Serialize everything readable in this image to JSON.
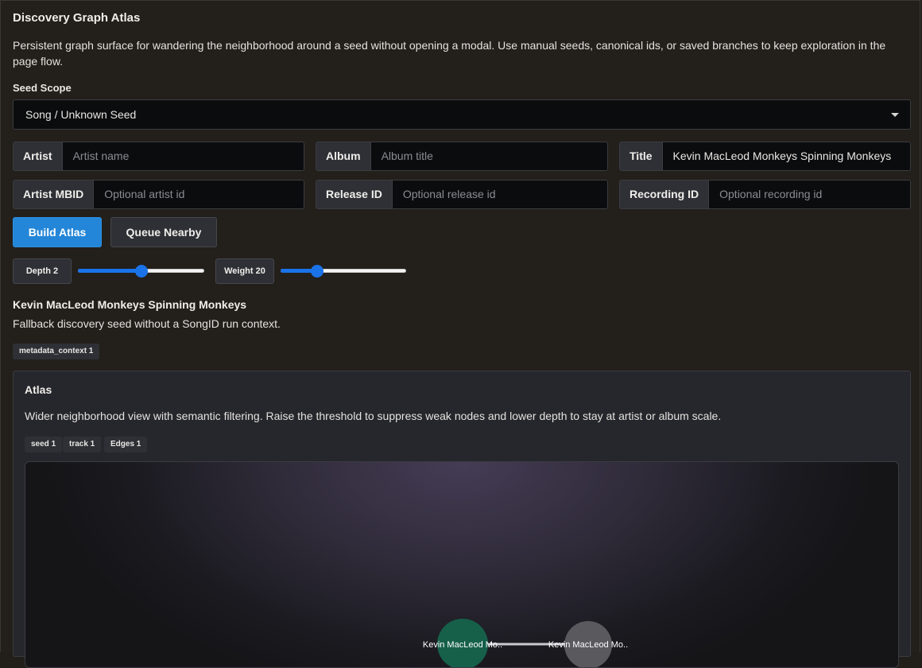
{
  "header": {
    "title": "Discovery Graph Atlas",
    "description": "Persistent graph surface for wandering the neighborhood around a seed without opening a modal. Use manual seeds, canonical ids, or saved branches to keep exploration in the page flow."
  },
  "scope": {
    "label": "Seed Scope",
    "selected": "Song / Unknown Seed"
  },
  "fields": {
    "artist": {
      "label": "Artist",
      "value": "",
      "placeholder": "Artist name"
    },
    "album": {
      "label": "Album",
      "value": "",
      "placeholder": "Album title"
    },
    "title": {
      "label": "Title",
      "value": "Kevin MacLeod Monkeys Spinning Monkeys",
      "placeholder": ""
    },
    "artist_mbid": {
      "label": "Artist MBID",
      "value": "",
      "placeholder": "Optional artist id"
    },
    "release_id": {
      "label": "Release ID",
      "value": "",
      "placeholder": "Optional release id"
    },
    "recording_id": {
      "label": "Recording ID",
      "value": "",
      "placeholder": "Optional recording id"
    }
  },
  "actions": {
    "build_label": "Build Atlas",
    "queue_label": "Queue Nearby"
  },
  "controls": {
    "depth_label": "Depth 2",
    "depth_value": 2,
    "depth_fraction": 0.5,
    "weight_label": "Weight 20",
    "weight_value": 20,
    "weight_fraction": 0.29
  },
  "seed": {
    "title": "Kevin MacLeod Monkeys Spinning Monkeys",
    "subtitle": "Fallback discovery seed without a SongID run context.",
    "tag": "metadata_context 1"
  },
  "atlas": {
    "title": "Atlas",
    "description": "Wider neighborhood view with semantic filtering. Raise the threshold to suppress weak nodes and lower depth to stay at artist or album scale.",
    "tags": [
      "seed 1",
      "track 1",
      "Edges 1"
    ],
    "nodes": [
      {
        "label": "Kevin MacLeod Mo..",
        "kind": "seed",
        "color": "#16604a"
      },
      {
        "label": "Kevin MacLeod Mo..",
        "kind": "track",
        "color": "#5a5a5e"
      }
    ],
    "edge_color": "#c9c9cf"
  }
}
